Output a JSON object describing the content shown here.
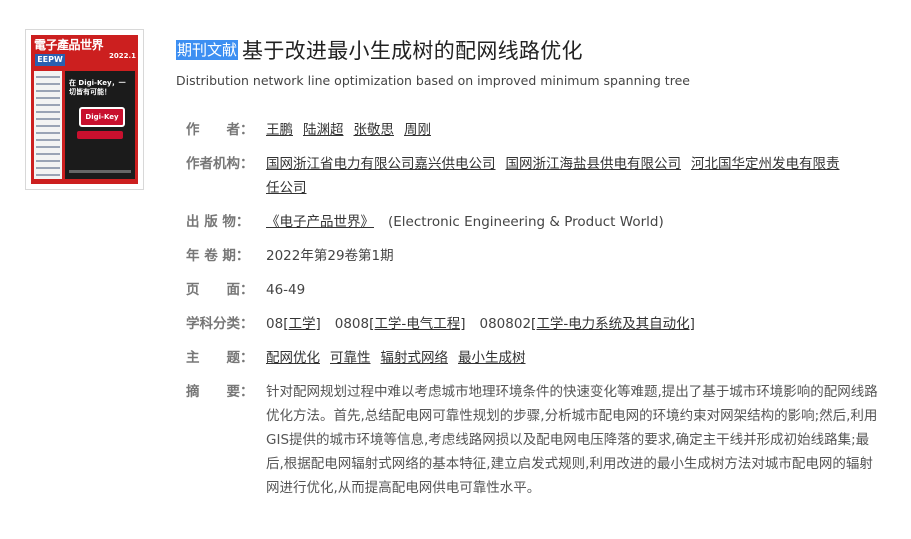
{
  "cover": {
    "masthead": "電子產品世界",
    "issue": "2022.1",
    "brand": "EEPW",
    "headline": "在 Digi-Key，一切皆有可能！",
    "logo": "Digi-Key"
  },
  "article": {
    "tag": "期刊文献",
    "title": "基于改进最小生成树的配网线路优化",
    "subtitle": "Distribution network line optimization based on improved minimum spanning tree"
  },
  "meta": {
    "authors_label": "作　　者：",
    "authors": [
      "王鹏",
      "陆渊超",
      "张敬思",
      "周刚"
    ],
    "org_label": "作者机构：",
    "orgs_line1": [
      "国网浙江省电力有限公司嘉兴供电公司",
      "国网浙江海盐县供电有限公司",
      "河北国华定州发电有限责"
    ],
    "orgs_line2": "任公司",
    "pub_label": "出 版 物：",
    "pub_name": "《电子产品世界》",
    "pub_en": "(Electronic Engineering & Product World)",
    "issue_label": "年 卷 期：",
    "issue_value": "2022年第29卷第1期",
    "pages_label": "页　　面：",
    "pages_value": "46-49",
    "subject_label": "学科分类：",
    "subjects": [
      {
        "code": "08",
        "name": "[工学]"
      },
      {
        "code": "0808",
        "name": "[工学-电气工程]"
      },
      {
        "code": "080802",
        "name": "[工学-电力系统及其自动化]"
      }
    ],
    "keywords_label": "主　　题：",
    "keywords": [
      "配网优化",
      "可靠性",
      "辐射式网络",
      "最小生成树"
    ],
    "abstract_label": "摘　　要：",
    "abstract": "针对配网规划过程中难以考虑城市地理环境条件的快速变化等难题,提出了基于城市环境影响的配网线路优化方法。首先,总结配电网可靠性规划的步骤,分析城市配电网的环境约束对网架结构的影响;然后,利用GIS提供的城市环境等信息,考虑线路网损以及配电网电压降落的要求,确定主干线并形成初始线路集;最后,根据配电网辐射式网络的基本特征,建立启发式规则,利用改进的最小生成树方法对城市配电网的辐射网进行优化,从而提高配电网供电可靠性水平。"
  }
}
